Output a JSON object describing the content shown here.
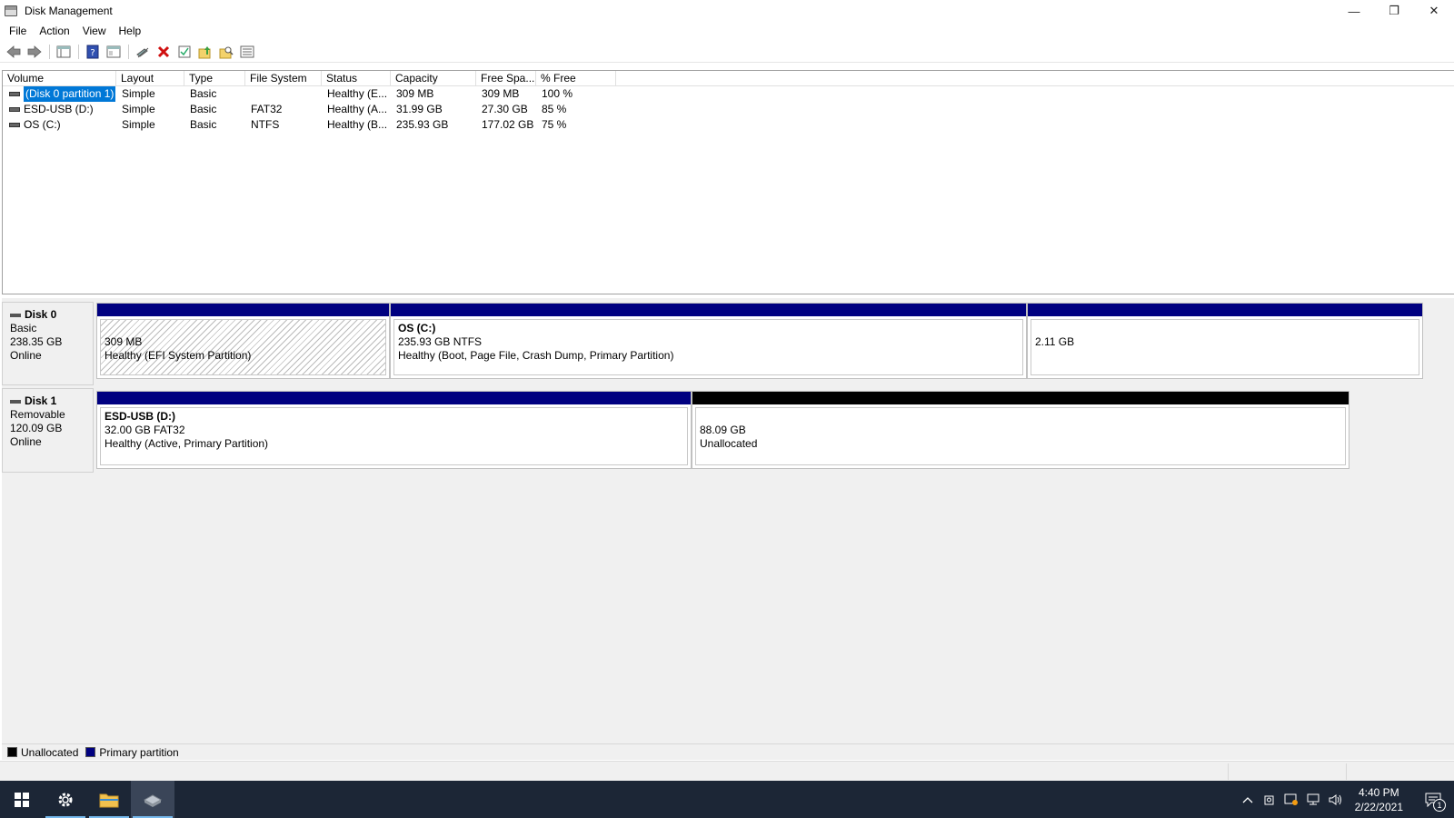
{
  "window": {
    "title": "Disk Management",
    "minimize_glyph": "—",
    "restore_glyph": "❐",
    "close_glyph": "✕"
  },
  "menu": [
    "File",
    "Action",
    "View",
    "Help"
  ],
  "toolbar_icons": [
    "back-arrow-icon",
    "forward-arrow-icon",
    "console-tree-icon",
    "help-icon",
    "properties-icon",
    "connect-icon",
    "delete-icon",
    "check-icon",
    "import-icon",
    "rescan-icon",
    "list-icon"
  ],
  "volume_list": {
    "columns": [
      "Volume",
      "Layout",
      "Type",
      "File System",
      "Status",
      "Capacity",
      "Free Spa...",
      "% Free"
    ],
    "rows": [
      {
        "volume": "(Disk 0 partition 1)",
        "layout": "Simple",
        "type": "Basic",
        "fs": "",
        "status": "Healthy (E...",
        "capacity": "309 MB",
        "free": "309 MB",
        "pct": "100 %"
      },
      {
        "volume": "ESD-USB (D:)",
        "layout": "Simple",
        "type": "Basic",
        "fs": "FAT32",
        "status": "Healthy (A...",
        "capacity": "31.99 GB",
        "free": "27.30 GB",
        "pct": "85 %"
      },
      {
        "volume": "OS (C:)",
        "layout": "Simple",
        "type": "Basic",
        "fs": "NTFS",
        "status": "Healthy (B...",
        "capacity": "235.93 GB",
        "free": "177.02 GB",
        "pct": "75 %"
      }
    ]
  },
  "disks": [
    {
      "name": "Disk 0",
      "kind": "Basic",
      "size": "238.35 GB",
      "state": "Online",
      "partitions": [
        {
          "title": "",
          "line1": "309 MB",
          "line2": "Healthy (EFI System Partition)"
        },
        {
          "title": "OS  (C:)",
          "line1": "235.93 GB NTFS",
          "line2": "Healthy (Boot, Page File, Crash Dump, Primary Partition)"
        },
        {
          "title": "",
          "line1": "2.11 GB",
          "line2": ""
        }
      ]
    },
    {
      "name": "Disk 1",
      "kind": "Removable",
      "size": "120.09 GB",
      "state": "Online",
      "partitions": [
        {
          "title": "ESD-USB  (D:)",
          "line1": "32.00 GB FAT32",
          "line2": "Healthy (Active, Primary Partition)"
        },
        {
          "title": "",
          "line1": "88.09 GB",
          "line2": "Unallocated"
        }
      ]
    }
  ],
  "legend": [
    {
      "label": "Unallocated",
      "color": "#000000"
    },
    {
      "label": "Primary partition",
      "color": "#000080"
    }
  ],
  "colors": {
    "primary": "#000080",
    "unallocated": "#000000",
    "selection": "#0078d7",
    "taskbar": "#1c2636"
  },
  "taskbar": {
    "apps": [
      "start-icon",
      "settings-icon",
      "file-explorer-icon",
      "disk-management-icon"
    ],
    "time": "4:40 PM",
    "date": "2/22/2021",
    "notification_count": "1"
  }
}
